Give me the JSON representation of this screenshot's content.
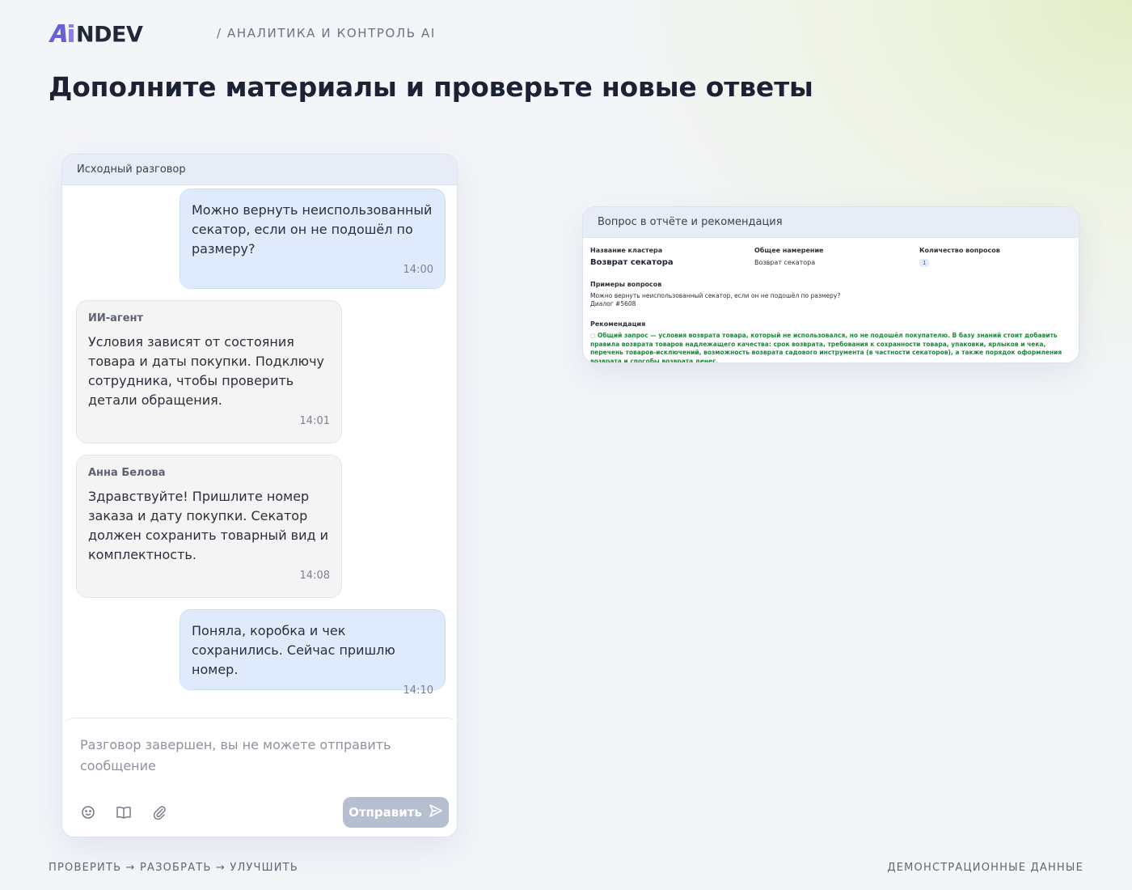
{
  "brand": {
    "logo_text": "AiNDEV",
    "tagline": "/ АНАЛИТИКА И КОНТРОЛЬ AI"
  },
  "page_title": "Дополните материалы и проверьте новые ответы",
  "chat": {
    "header": "Исходный разговор",
    "messages": [
      {
        "role": "user",
        "text": "Можно вернуть неиспользованный секатор, если он не подошёл по размеру?",
        "time": "14:00"
      },
      {
        "role": "agent",
        "sender": "ИИ-агент",
        "text": "Условия зависят от состояния товара и даты покупки. Подключу сотрудника, чтобы проверить детали обращения.",
        "time": "14:01"
      },
      {
        "role": "agent",
        "sender": "Анна Белова",
        "text": "Здравствуйте! Пришлите номер заказа и дату покупки. Секатор должен сохранить товарный вид и комплектность.",
        "time": "14:08"
      },
      {
        "role": "user",
        "text": "Поняла, коробка и чек сохранились. Сейчас пришлю номер.",
        "time": "14:10"
      }
    ],
    "composer_placeholder": "Разговор завершен, вы не можете отправить сообщение",
    "tools": [
      "emoji-icon",
      "book-icon",
      "paperclip-icon"
    ],
    "send_label": "Отправить"
  },
  "report": {
    "header": "Вопрос в отчёте и рекомендация",
    "cluster_label": "Название кластера",
    "cluster_value": "Возврат секатора",
    "intent_label": "Общее намерение",
    "intent_value": "Возврат секатора",
    "count_label": "Количество вопросов",
    "count_value": "1",
    "examples_label": "Примеры вопросов",
    "example_question": "Можно вернуть неиспользованный секатор, если он не подошёл по размеру?",
    "example_dialog": "Диалог #5608",
    "recommendation_label": "Рекомендация",
    "recommendation_text": "Общий запрос — условия возврата товара, который не использовался, но не подошёл покупателю. В базу знаний стоит добавить правила возврата товаров надлежащего качества: срок возврата, требования к сохранности товара, упаковки, ярлыков и чека, перечень товаров-исключений, возможность возврата садового инструмента (в частности секаторов), а также порядок оформления возврата и способы возврата денег."
  },
  "footer": {
    "left": "ПРОВЕРИТЬ → РАЗОБРАТЬ → УЛУЧШИТЬ",
    "right": "ДЕМОНСТРАЦИОННЫЕ ДАННЫЕ"
  },
  "colors": {
    "logo_purple": "#6b5fd6",
    "logo_dark": "#222838",
    "user_bubble": "#dfeafd",
    "agent_bubble": "#f4f4f5",
    "send_button": "#b5bfcf",
    "recommendation_green": "#1a8a3a"
  }
}
